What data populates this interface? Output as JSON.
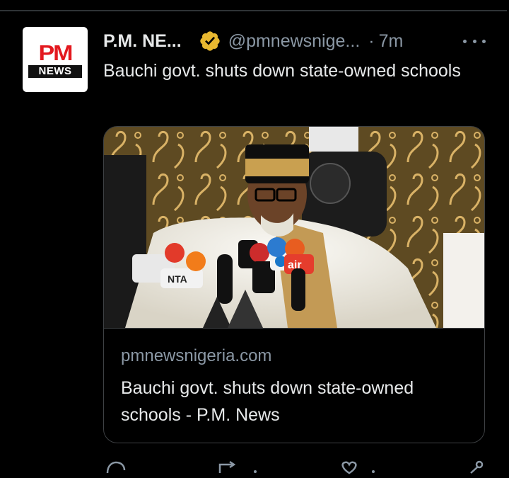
{
  "tweet": {
    "avatar": {
      "brand_top": "PM",
      "brand_bottom": "NEWS",
      "brand_color": "#e3191f"
    },
    "author_name": "P.M. NE...",
    "verified_icon": "verified-gold-badge",
    "handle": "@pmnewsnige...",
    "separator": "·",
    "time": "7m",
    "more_icon": "more-horizontal-icon",
    "text": "Bauchi govt. shuts down state-owned schools"
  },
  "card": {
    "image_alt": "Man in a white embroidered robe and cap speaking into a cluster of microphones at a press conference",
    "domain": "pmnewsnigeria.com",
    "title": "Bauchi govt. shuts down state-owned schools - P.M. News"
  },
  "actions": [
    {
      "icon": "reply-icon"
    },
    {
      "icon": "retweet-icon"
    },
    {
      "icon": "like-icon"
    },
    {
      "icon": "share-icon"
    }
  ],
  "colors": {
    "background": "#000000",
    "text_primary": "#e7e9ea",
    "text_secondary": "#8b98a5",
    "border": "#3e4144",
    "verified_gold": "#e8b830"
  }
}
